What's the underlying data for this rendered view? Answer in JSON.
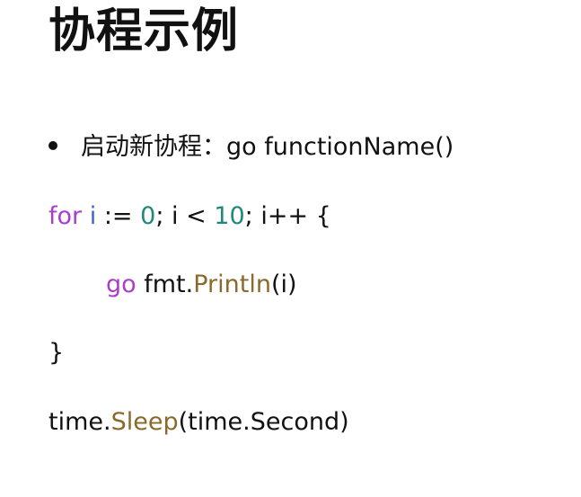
{
  "title": "协程示例",
  "bullet": {
    "label": "启动新协程：",
    "code": "go functionName()"
  },
  "code": {
    "for_line": {
      "kw_for": "for",
      "var_i": "i",
      "assign": " := ",
      "zero": "0",
      "cond": "; i < ",
      "ten": "10",
      "rest": "; i++ {"
    },
    "go_line": {
      "kw_go": "go",
      "pkg": " fmt.",
      "func": "Println",
      "args": "(i)"
    },
    "close_line": "}",
    "sleep_line": {
      "pkg": "time.",
      "func": "Sleep",
      "args": "(time.Second)"
    }
  },
  "colors": {
    "keyword": "#a93fc9",
    "number": "#1f8a7a",
    "function": "#8a6a2a",
    "variable": "#3a5fd6",
    "text": "#111111",
    "background": "#ffffff"
  }
}
